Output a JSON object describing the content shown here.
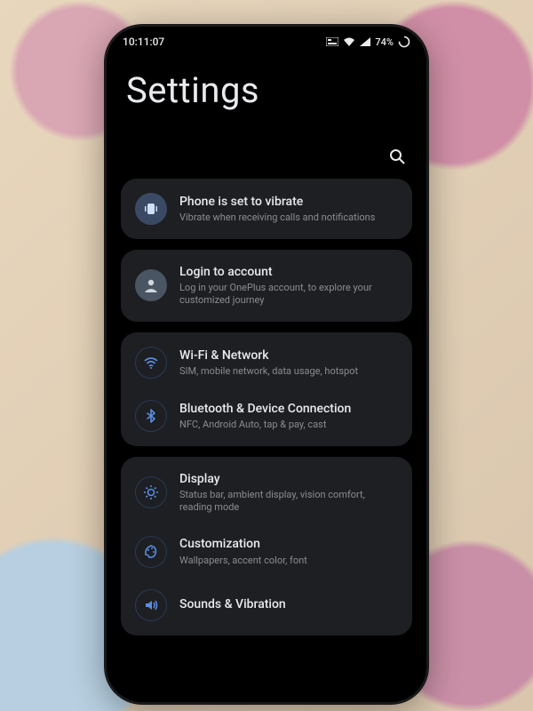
{
  "status": {
    "time": "10:11:07",
    "battery_text": "74%"
  },
  "page": {
    "title": "Settings"
  },
  "cards": {
    "vibrate": {
      "title": "Phone is set to vibrate",
      "sub": "Vibrate when receiving calls and notifications"
    },
    "account": {
      "title": "Login to account",
      "sub": "Log in your OnePlus account, to explore your customized journey"
    },
    "wifi": {
      "title": "Wi-Fi & Network",
      "sub": "SIM, mobile network, data usage, hotspot"
    },
    "bluetooth": {
      "title": "Bluetooth & Device Connection",
      "sub": "NFC, Android Auto, tap & pay, cast"
    },
    "display": {
      "title": "Display",
      "sub": "Status bar, ambient display, vision comfort, reading mode"
    },
    "custom": {
      "title": "Customization",
      "sub": "Wallpapers, accent color, font"
    },
    "sounds": {
      "title": "Sounds & Vibration",
      "sub": ""
    }
  }
}
